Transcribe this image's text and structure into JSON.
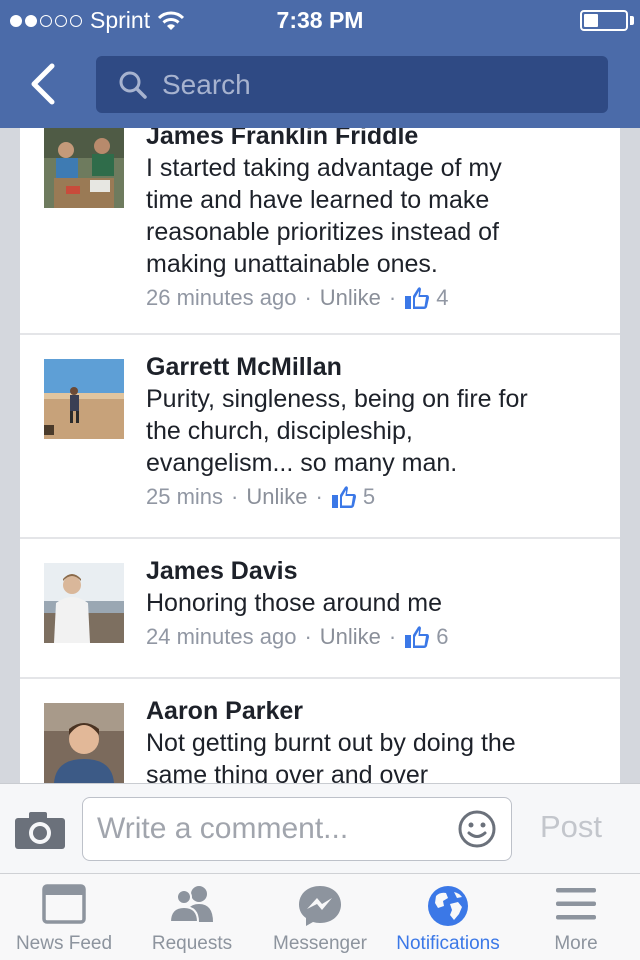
{
  "status": {
    "carrier": "Sprint",
    "time": "7:38 PM",
    "signal_bars": 2,
    "battery_level": 0.35
  },
  "header": {
    "back_icon": "chevron-left-icon",
    "search_placeholder": "Search"
  },
  "comments": [
    {
      "name": "James Franklin Friddle",
      "lines": [
        "I started taking advantage of my",
        "time and have learned to make",
        "reasonable prioritizes instead of",
        "making unattainable ones."
      ],
      "time": "26 minutes ago",
      "action": "Unlike",
      "likes": "4"
    },
    {
      "name": "Garrett McMillan",
      "lines": [
        "Purity, singleness, being on fire for",
        "the church, discipleship,",
        "evangelism... so many man."
      ],
      "time": "25 mins",
      "action": "Unlike",
      "likes": "5"
    },
    {
      "name": "James Davis",
      "lines": [
        "Honoring those around me"
      ],
      "time": "24 minutes ago",
      "action": "Unlike",
      "likes": "6"
    },
    {
      "name": "Aaron Parker",
      "lines": [
        "Not getting burnt out by doing the",
        "same thing over and over"
      ],
      "time": "",
      "action": "",
      "likes": ""
    }
  ],
  "composer": {
    "placeholder": "Write a comment...",
    "post_label": "Post"
  },
  "tabs": [
    {
      "label": "News Feed",
      "icon": "news-feed-icon",
      "active": false
    },
    {
      "label": "Requests",
      "icon": "friend-requests-icon",
      "active": false
    },
    {
      "label": "Messenger",
      "icon": "messenger-icon",
      "active": false
    },
    {
      "label": "Notifications",
      "icon": "globe-icon",
      "active": true
    },
    {
      "label": "More",
      "icon": "menu-icon",
      "active": false
    }
  ],
  "colors": {
    "header": "#4b6ba9",
    "search_bg": "#2f4a84",
    "active_tab": "#3b78e7",
    "inactive_tab": "#8d949e",
    "like_blue": "#3b78e7"
  }
}
